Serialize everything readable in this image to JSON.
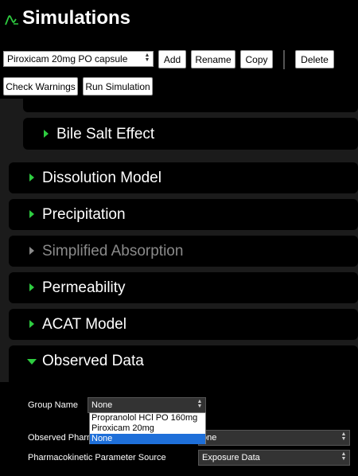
{
  "header": {
    "title": "Simulations",
    "logo_icon": "curve-logo-icon",
    "accent_color": "#2ecc40"
  },
  "toolbar": {
    "simulation_select_value": "Piroxicam 20mg PO capsule",
    "add_label": "Add",
    "rename_label": "Rename",
    "copy_label": "Copy",
    "delete_label": "Delete",
    "check_warnings_label": "Check Warnings",
    "run_simulation_label": "Run Simulation"
  },
  "sections": {
    "bile_salt_effect": "Bile Salt Effect",
    "dissolution_model": "Dissolution Model",
    "precipitation": "Precipitation",
    "simplified_absorption": "Simplified Absorption",
    "permeability": "Permeability",
    "acat_model": "ACAT Model",
    "observed_data": "Observed Data"
  },
  "observed_data_form": {
    "group_name_label": "Group Name",
    "group_name_value": "None",
    "group_name_options": [
      "Propranolol HCl PO 160mg",
      "Piroxicam 20mg",
      "None"
    ],
    "group_name_selected_index": 2,
    "observed_pharm_label": "Observed Pharm",
    "observed_pharm_value": "one",
    "pk_source_label": "Pharmacokinetic Parameter Source",
    "pk_source_value": "Exposure Data"
  }
}
